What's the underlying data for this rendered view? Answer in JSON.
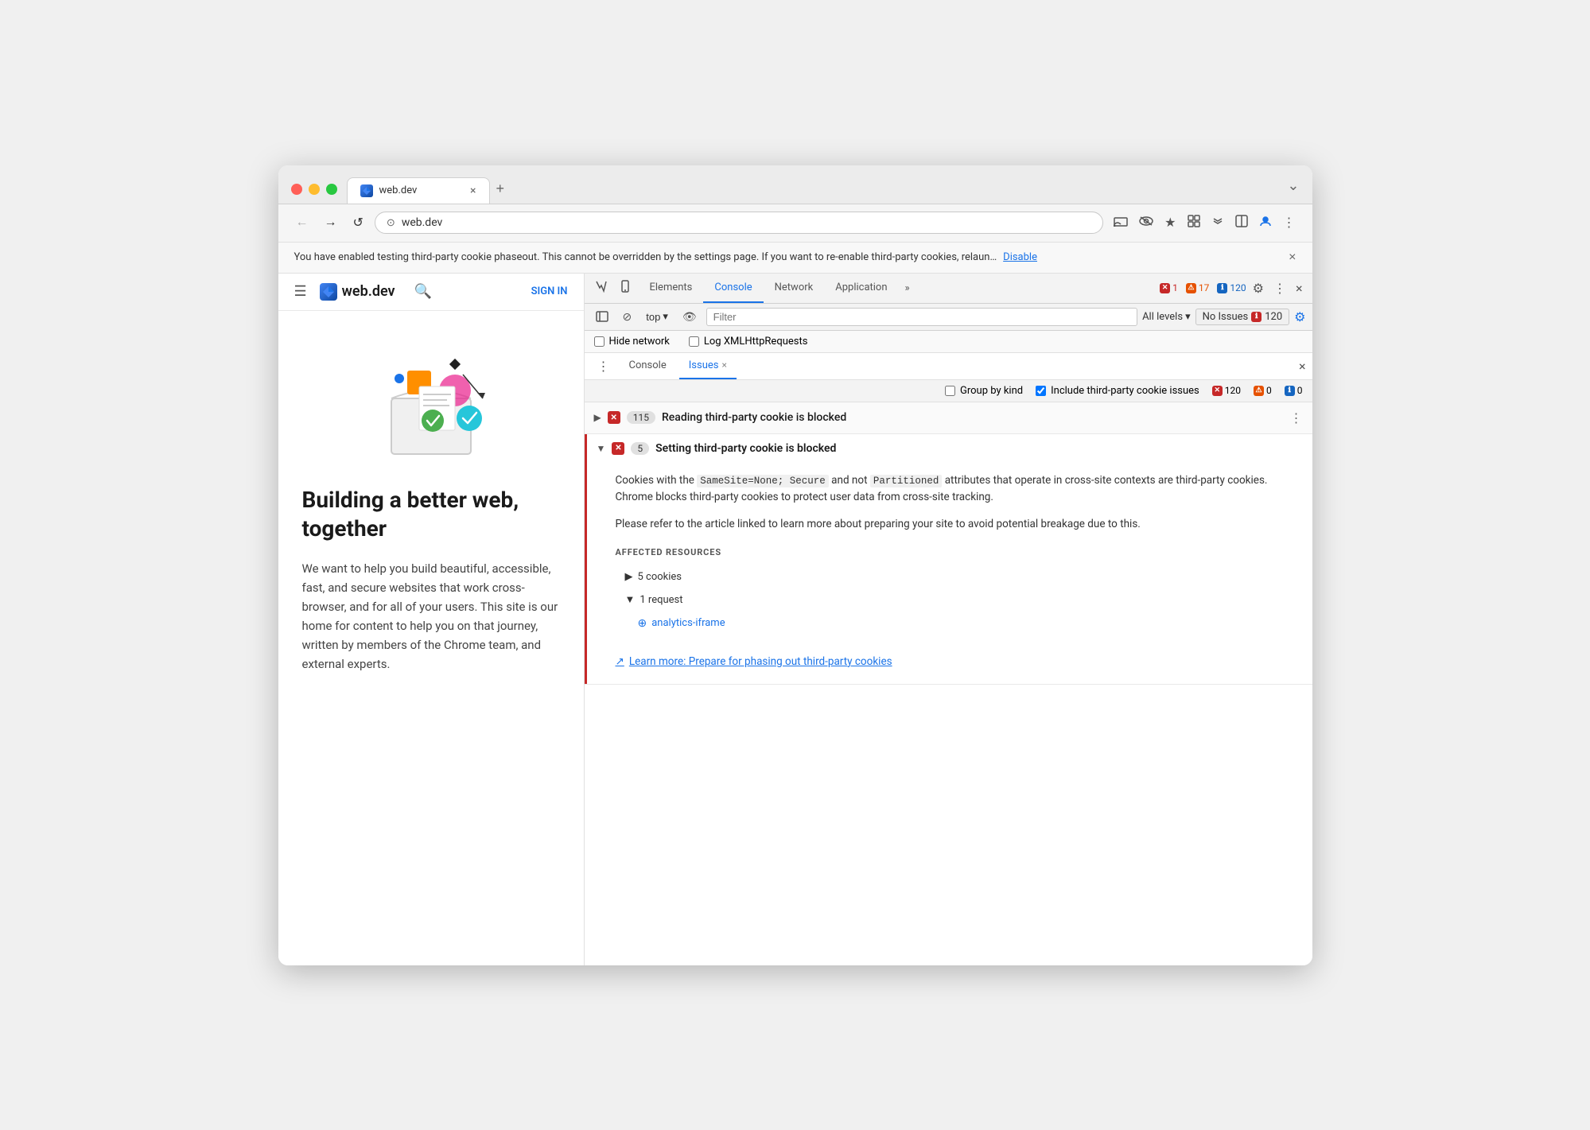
{
  "browser": {
    "tab_label": "web.dev",
    "tab_favicon": "W",
    "url": "web.dev",
    "new_tab_label": "+",
    "chevron_label": "⌄"
  },
  "nav": {
    "back_label": "←",
    "forward_label": "→",
    "refresh_label": "↺",
    "address": "web.dev",
    "cast_title": "Cast",
    "eye_title": "Hide",
    "bookmark_title": "Bookmark",
    "extensions_title": "Extensions",
    "devtools_title": "DevTools",
    "profile_title": "Profile",
    "menu_title": "Menu"
  },
  "notification": {
    "text": "You have enabled testing third-party cookie phaseout. This cannot be overridden by the settings page. If you want to re-enable third-party cookies, relaun…",
    "action_label": "Disable",
    "close_label": "×"
  },
  "website": {
    "menu_label": "☰",
    "logo_label": "web.dev",
    "search_label": "🔍",
    "signin_label": "SIGN IN",
    "headline": "Building a better web, together",
    "body_text": "We want to help you build beautiful, accessible, fast, and secure websites that work cross-browser, and for all of your users. This site is our home for content to help you on that journey, written by members of the Chrome team, and external experts."
  },
  "devtools": {
    "tool1_label": "⊞",
    "tool2_label": "⊡",
    "tabs": [
      {
        "label": "Elements",
        "active": false
      },
      {
        "label": "Console",
        "active": false
      },
      {
        "label": "Network",
        "active": false
      },
      {
        "label": "Application",
        "active": false
      }
    ],
    "active_tab": "Console",
    "more_tabs_label": "»",
    "badges": {
      "error_count": "1",
      "warn_count": "17",
      "info_count": "120"
    },
    "gear_label": "⚙",
    "more_label": "⋮",
    "close_label": "×",
    "toolbar": {
      "sidebar_label": "⊞",
      "block_label": "⊘",
      "context_label": "top",
      "context_arrow": "▾",
      "eye_label": "👁",
      "filter_placeholder": "Filter",
      "levels_label": "All levels",
      "levels_arrow": "▾",
      "no_issues_label": "No Issues",
      "no_issues_count": "120",
      "gear_label": "⚙"
    },
    "checkboxes": {
      "hide_network_label": "Hide network",
      "log_xml_label": "Log XMLHttpRequests"
    },
    "subtabs": {
      "more_label": "⋮",
      "console_label": "Console",
      "issues_label": "Issues",
      "issues_close": "×",
      "close_label": "×"
    },
    "issues_options": {
      "group_by_kind_label": "Group by kind",
      "include_label": "Include third-party cookie issues",
      "count": "120",
      "warn_count": "0",
      "info_count": "0"
    },
    "issue_reading": {
      "title": "Reading third-party cookie is blocked",
      "count": "115",
      "expanded": false
    },
    "issue_setting": {
      "title": "Setting third-party cookie is blocked",
      "count": "5",
      "expanded": true,
      "body_p1_before": "Cookies with the ",
      "body_code1": "SameSite=None; Secure",
      "body_p1_middle": " and not ",
      "body_code2": "Partitioned",
      "body_p1_after": " attributes that operate in cross-site contexts are third-party cookies. Chrome blocks third-party cookies to protect user data from cross-site tracking.",
      "body_p2": "Please refer to the article linked to learn more about preparing your site to avoid potential breakage due to this.",
      "affected_label": "AFFECTED RESOURCES",
      "resource1": "▶ 5 cookies",
      "resource2_label": "1 request",
      "resource2_sub": "analytics-iframe",
      "learn_more": "Learn more: Prepare for phasing out third-party cookies"
    }
  }
}
